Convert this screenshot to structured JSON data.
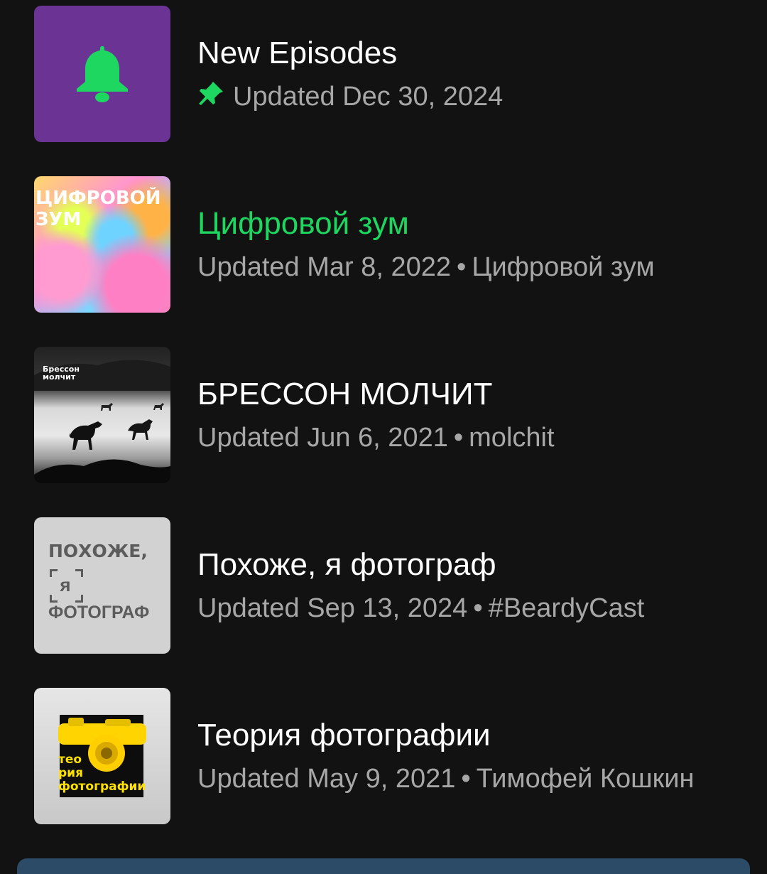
{
  "colors": {
    "background": "#121212",
    "accent": "#1ed760",
    "secondary_text": "#a7a7a7",
    "new_episodes_tile": "#6b3494"
  },
  "items": [
    {
      "title": "New Episodes",
      "meta": "Updated Dec 30, 2024",
      "owner": "",
      "pinned": true,
      "active": false,
      "icon": "bell-icon"
    },
    {
      "title": "Цифровой зум",
      "meta": "Updated Mar 8, 2022",
      "owner": "Цифровой зум",
      "pinned": false,
      "active": true,
      "cover_text": [
        "ЦИФРОВОЙ",
        "ЗУМ"
      ]
    },
    {
      "title": "БРЕССОН МОЛЧИТ",
      "meta": "Updated Jun 6, 2021",
      "owner": "molchit",
      "pinned": false,
      "active": false,
      "cover_text": [
        "Брессон",
        "молчит"
      ]
    },
    {
      "title": "Похоже, я фотограф",
      "meta": "Updated Sep 13, 2024",
      "owner": "#BeardyCast",
      "pinned": false,
      "active": false,
      "cover_text": [
        "ПОХОЖЕ,",
        "я",
        "ФОТОГРАФ"
      ]
    },
    {
      "title": "Теория фотографии",
      "meta": "Updated May 9, 2021",
      "owner": "Тимофей Кошкин",
      "pinned": false,
      "active": false,
      "cover_text": [
        "тео",
        "рия",
        "фотографии"
      ]
    }
  ],
  "separator": "•"
}
